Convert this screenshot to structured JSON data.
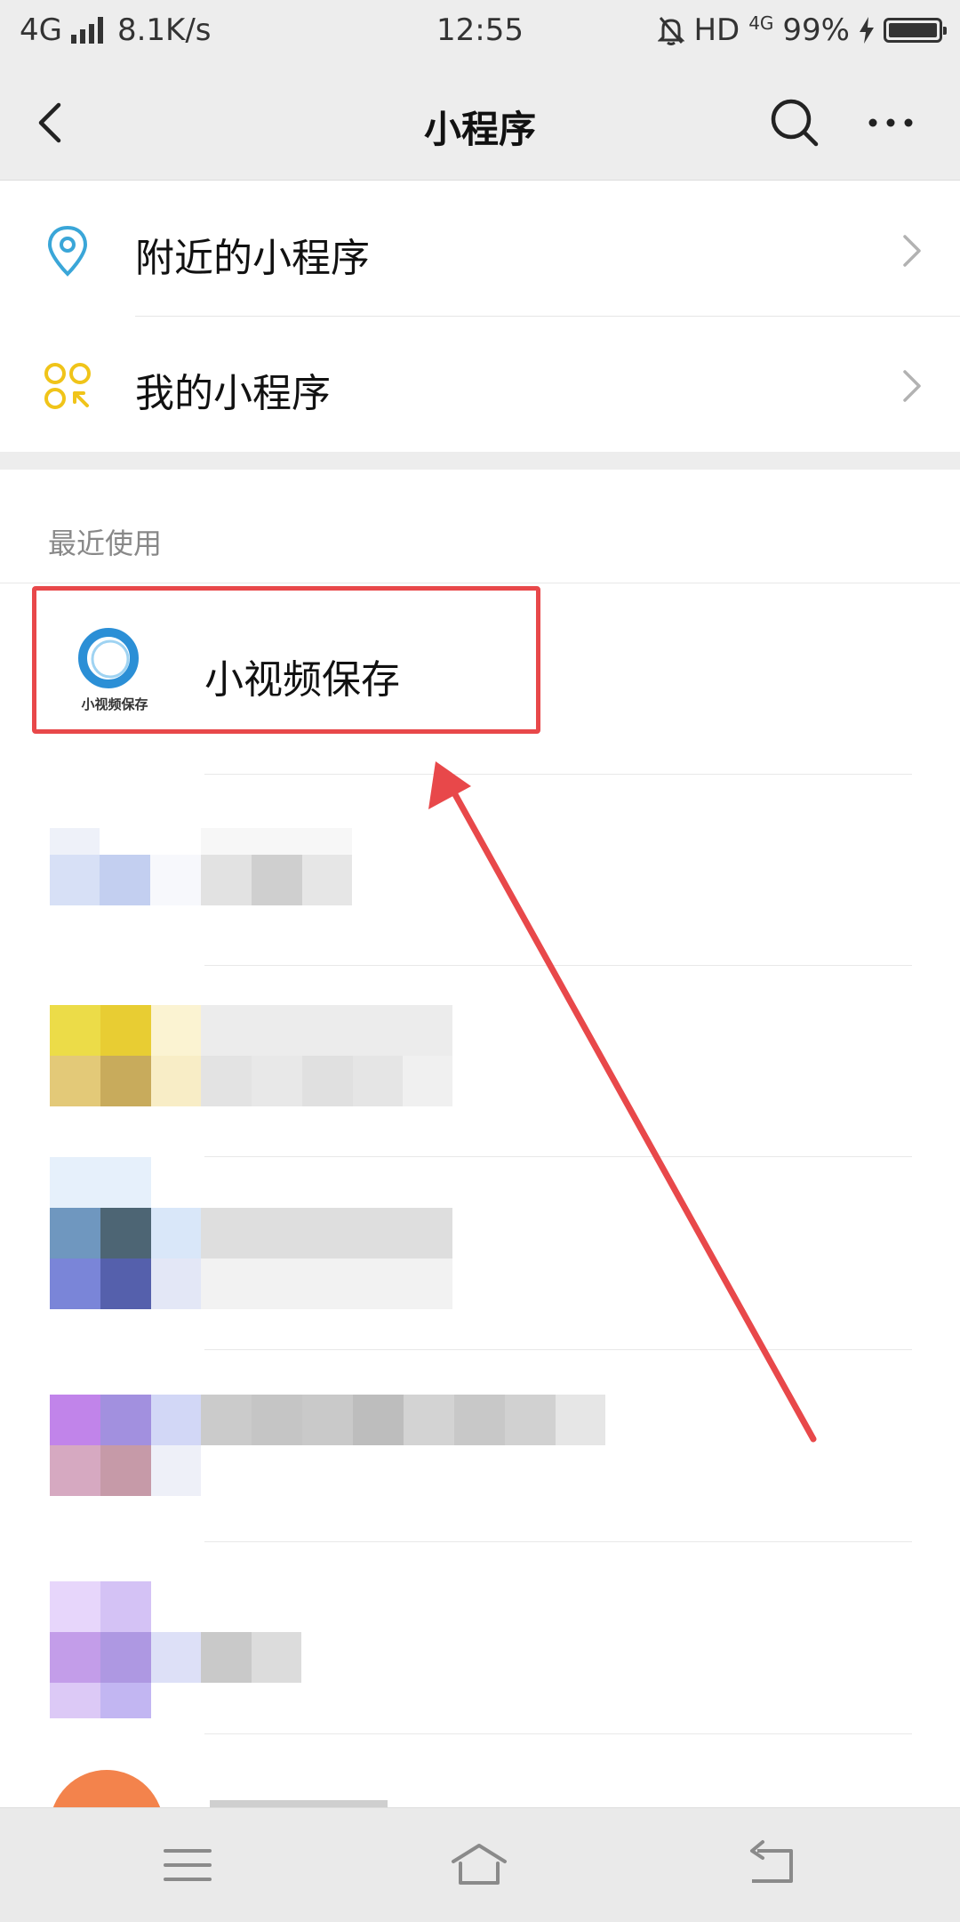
{
  "status_bar": {
    "network": "4G",
    "speed": "8.1K/s",
    "time": "12:55",
    "hd": "HD",
    "net_small": "4G",
    "battery": "99%"
  },
  "nav": {
    "title": "小程序"
  },
  "menu": {
    "nearby_label": "附近的小程序",
    "mine_label": "我的小程序"
  },
  "recent": {
    "header": "最近使用",
    "app_name": "小视频保存",
    "app_logo_text": "小视频保存"
  },
  "colors": {
    "highlight": "#e8484a",
    "location_icon": "#3aa6d8",
    "my_apps_icon": "#f0c419",
    "logo_ring": "#2b8fd6"
  }
}
